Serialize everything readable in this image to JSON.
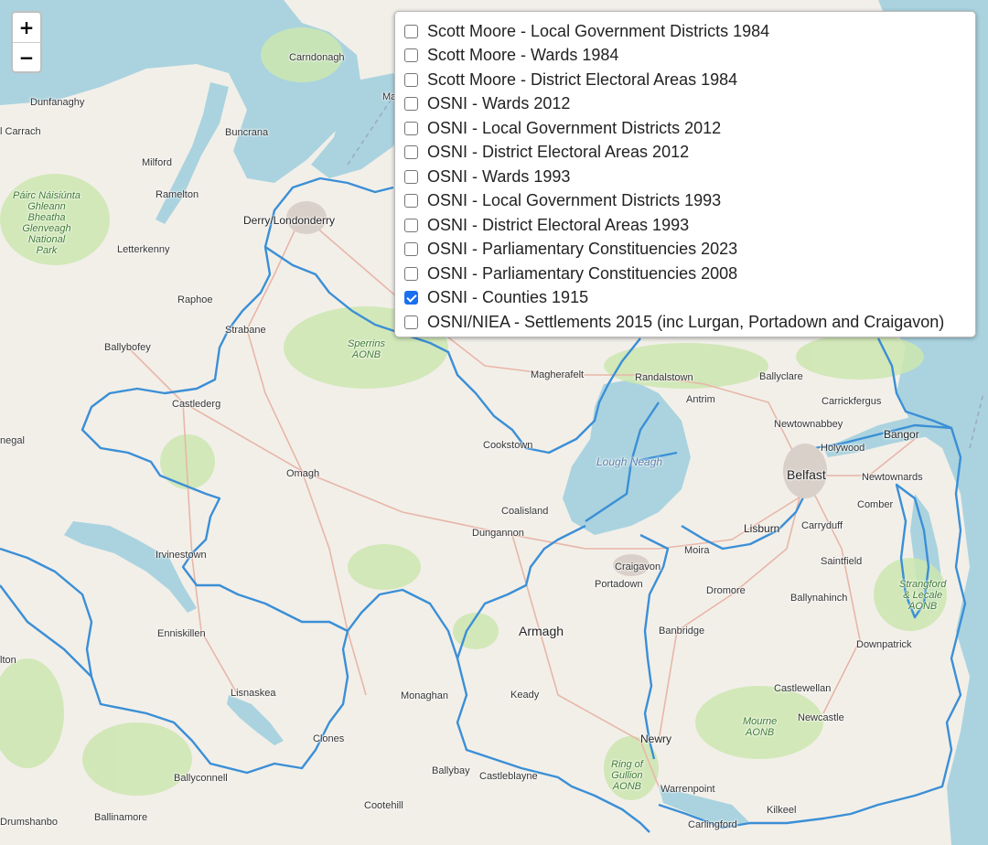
{
  "zoom": {
    "in_label": "+",
    "out_label": "−"
  },
  "layers": [
    {
      "label": "Scott Moore - Local Government Districts 1984",
      "checked": false
    },
    {
      "label": "Scott Moore - Wards 1984",
      "checked": false
    },
    {
      "label": "Scott Moore - District Electoral Areas 1984",
      "checked": false
    },
    {
      "label": "OSNI - Wards 2012",
      "checked": false
    },
    {
      "label": "OSNI - Local Government Districts 2012",
      "checked": false
    },
    {
      "label": "OSNI - District Electoral Areas 2012",
      "checked": false
    },
    {
      "label": "OSNI - Wards 1993",
      "checked": false
    },
    {
      "label": "OSNI - Local Government Districts 1993",
      "checked": false
    },
    {
      "label": "OSNI - District Electoral Areas 1993",
      "checked": false
    },
    {
      "label": "OSNI - Parliamentary Constituencies 2023",
      "checked": false
    },
    {
      "label": "OSNI - Parliamentary Constituencies 2008",
      "checked": false
    },
    {
      "label": "OSNI - Counties 1915",
      "checked": true
    },
    {
      "label": "OSNI/NIEA - Settlements 2015 (inc Lurgan, Portadown and Craigavon)",
      "checked": false
    }
  ],
  "places": {
    "carndonagh": "Carndonagh",
    "dunfanaghy": "Dunfanaghy",
    "carrach": "l Carrach",
    "buncrana": "Buncrana",
    "milford": "Milford",
    "ramelton": "Ramelton",
    "derry": "Derry/Londonderry",
    "letterkenny": "Letterkenny",
    "raphoe": "Raphoe",
    "strabane": "Strabane",
    "ballybofey": "Ballybofey",
    "castlederg": "Castlederg",
    "negal": "negal",
    "omagh": "Omagh",
    "irvinestown": "Irvinestown",
    "enniskillen": "Enniskillen",
    "lton": "lton",
    "lisnaskea": "Lisnaskea",
    "clones": "Clones",
    "ballyconnell": "Ballyconnell",
    "drumshanbo": "Drumshanbo",
    "ballinamore": "Ballinamore",
    "cootehill": "Cootehill",
    "ballybay": "Ballybay",
    "castleblayne": "Castleblayne",
    "monaghan": "Monaghan",
    "keady": "Keady",
    "armagh": "Armagh",
    "newry": "Newry",
    "warrenpoint": "Warrenpoint",
    "carlingford": "Carlingford",
    "kilkeel": "Kilkeel",
    "newcastle": "Newcastle",
    "castlewellan": "Castlewellan",
    "downpatrick": "Downpatrick",
    "banbridge": "Banbridge",
    "ballynahinch": "Ballynahinch",
    "dromore": "Dromore",
    "saintfield": "Saintfield",
    "portadown": "Portadown",
    "craigavon": "Craigavon",
    "moira": "Moira",
    "lisburn": "Lisburn",
    "carryduff": "Carryduff",
    "belfast": "Belfast",
    "comber": "Comber",
    "newtownards": "Newtownards",
    "bangor": "Bangor",
    "holywood": "Holywood",
    "newtownabbey": "Newtownabbey",
    "carrickfergus": "Carrickfergus",
    "ballyclare": "Ballyclare",
    "antrim": "Antrim",
    "randalstown": "Randalstown",
    "magherafelt": "Magherafelt",
    "cookstown": "Cookstown",
    "coalisland": "Coalisland",
    "dungannon": "Dungannon",
    "ma": "Ma"
  },
  "parks": {
    "glenveagh": [
      "Páirc Náisiúnta",
      "Ghleann",
      "Bheatha",
      "Glenveagh",
      "National",
      "Park"
    ],
    "sperrins": [
      "Sperrins",
      "AONB"
    ],
    "strangford": [
      "Strangford",
      "& Lecale",
      "AONB"
    ],
    "mourne": [
      "Mourne",
      "AONB"
    ],
    "gullion": [
      "Ring of",
      "Gullion",
      "AONB"
    ]
  },
  "waters": {
    "lough_neagh": "Lough Neagh"
  },
  "colors": {
    "land": "#f2efe9",
    "water": "#aad3df",
    "green": "#cde6b0",
    "county_border": "#3b8fd6",
    "checkbox_checked": "#1a6ff0"
  }
}
